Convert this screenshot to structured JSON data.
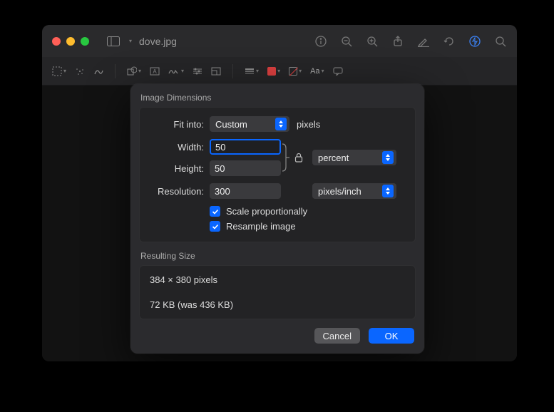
{
  "window": {
    "filename": "dove.jpg"
  },
  "dialog": {
    "section_image_dimensions": "Image Dimensions",
    "fit_into_label": "Fit into:",
    "fit_into_value": "Custom",
    "fit_into_unit": "pixels",
    "width_label": "Width:",
    "width_value": "50",
    "height_label": "Height:",
    "height_value": "50",
    "wh_unit": "percent",
    "resolution_label": "Resolution:",
    "resolution_value": "300",
    "resolution_unit": "pixels/inch",
    "scale_prop_label": "Scale proportionally",
    "resample_label": "Resample image",
    "section_resulting": "Resulting Size",
    "result_dims": "384 × 380 pixels",
    "result_size": "72 KB (was 436 KB)",
    "cancel": "Cancel",
    "ok": "OK"
  }
}
